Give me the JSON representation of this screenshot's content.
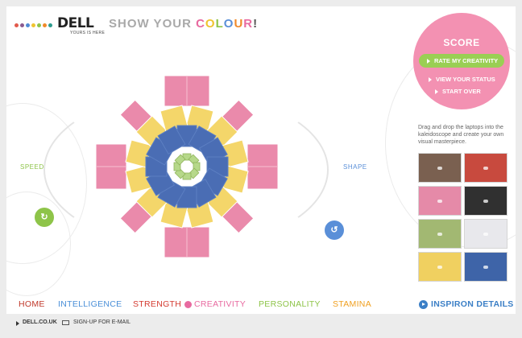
{
  "header": {
    "brand": "DELL",
    "tagline": "YOURS IS HERE",
    "title_prefix": "SHOW YOUR ",
    "title_word": [
      "C",
      "O",
      "L",
      "O",
      "U",
      "R"
    ],
    "title_suffix": "!",
    "logo_dot_colors": [
      "#e25a4c",
      "#8a5a8f",
      "#4e8bd6",
      "#f0c430",
      "#8ec449",
      "#f08a2a",
      "#2c9b8e"
    ]
  },
  "score": {
    "title": "SCORE",
    "rate_button": "RATE MY CREATIVITY",
    "view_status": "VIEW YOUR STATUS",
    "start_over": "START OVER"
  },
  "controls": {
    "speed_label": "SPEED",
    "shape_label": "SHAPE",
    "rotate_left_icon": "rotate-left-icon",
    "rotate_right_icon": "rotate-right-icon"
  },
  "instructions": "Drag and drop the laptops into the kaleidoscope and create your own visual masterpiece.",
  "palette": [
    {
      "name": "brown",
      "color": "#7a6050"
    },
    {
      "name": "red",
      "color": "#c84a3e"
    },
    {
      "name": "pink",
      "color": "#e58aa8"
    },
    {
      "name": "black",
      "color": "#303030"
    },
    {
      "name": "green",
      "color": "#a2b872"
    },
    {
      "name": "white",
      "color": "#e8e8ec"
    },
    {
      "name": "yellow",
      "color": "#f0d060"
    },
    {
      "name": "blue",
      "color": "#3e64a8"
    }
  ],
  "colors": {
    "pink": "#ea8aab",
    "yellow": "#f4d66a",
    "blue": "#4a6db4",
    "green": "#b6d88a",
    "speed": "#8ec449",
    "shape": "#5a8fd8"
  },
  "nav": {
    "home": "HOME",
    "intelligence": "INTELLIGENCE",
    "strength": "STRENGTH",
    "creativity": "CREATIVITY",
    "personality": "PERSONALITY",
    "stamina": "STAMINA",
    "inspiron": "INSPIRON DETAILS"
  },
  "footer": {
    "dell_link": "DELL.CO.UK",
    "signup": "SIGN-UP FOR E-MAIL"
  }
}
